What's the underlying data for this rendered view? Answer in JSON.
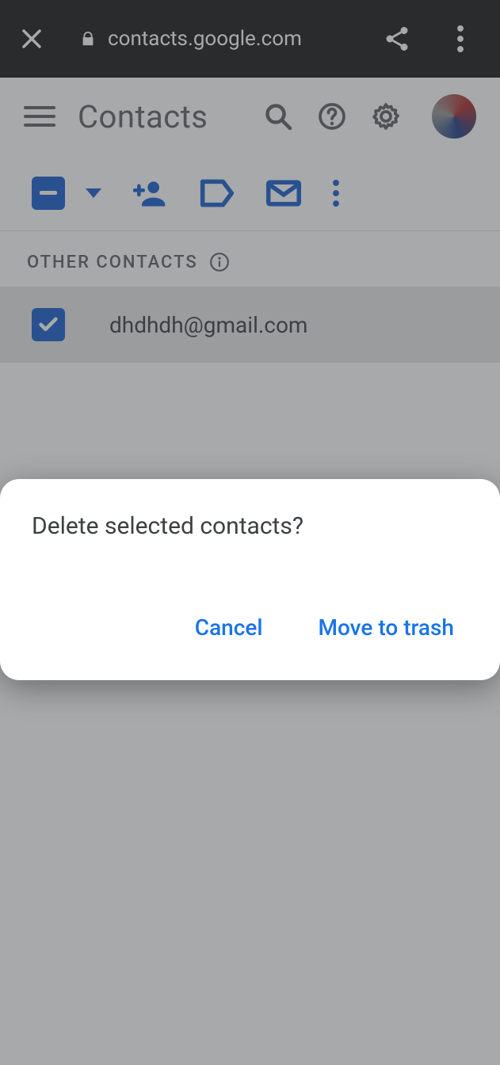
{
  "browser": {
    "url_host": "contacts.google.com"
  },
  "header": {
    "title": "Contacts"
  },
  "section": {
    "label": "OTHER CONTACTS"
  },
  "contacts": [
    {
      "email": "dhdhdh@gmail.com",
      "selected": true
    }
  ],
  "dialog": {
    "title": "Delete selected contacts?",
    "cancel": "Cancel",
    "confirm": "Move to trash"
  },
  "colors": {
    "accent": "#1a73e8",
    "checkbox": "#1a5fd0",
    "highlight": "#e02020"
  }
}
